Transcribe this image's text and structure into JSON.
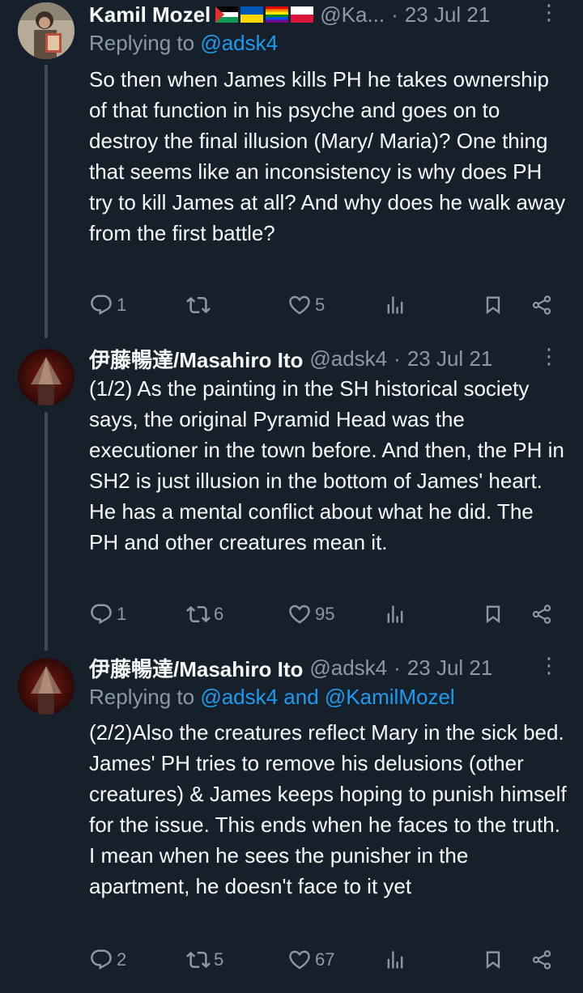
{
  "tweets": [
    {
      "author_name": "Kamil Mozel",
      "flags": [
        "palestine-flag",
        "ukraine-flag",
        "rainbow-flag",
        "poland-flag"
      ],
      "handle": "@Ka...",
      "date": "23 Jul 21",
      "replying_prefix": "Replying to",
      "replying_to": "@adsk4",
      "text": "So then when James kills PH he takes ownership of that function in his psyche and goes on to destroy the final illusion (Mary/ Maria)? One thing that seems like an inconsistency is why does PH try to kill James at all? And why does he walk away from the first battle?",
      "replies": "1",
      "retweets": "",
      "likes": "5"
    },
    {
      "author_name": "伊藤暢達/Masahiro Ito",
      "handle": "@adsk4",
      "date": "23 Jul 21",
      "text": "(1/2) As the painting in the SH historical society says, the original Pyramid Head was the executioner in the town before. And then, the PH in SH2 is just illusion in the bottom of James' heart. He has a mental conflict about what he did. The PH and other creatures mean it.",
      "replies": "1",
      "retweets": "6",
      "likes": "95"
    },
    {
      "author_name": "伊藤暢達/Masahiro Ito",
      "handle": "@adsk4",
      "date": "23 Jul 21",
      "replying_prefix": "Replying to",
      "replying_to": "@adsk4 and @KamilMozel",
      "text": "(2/2)Also the creatures reflect Mary in the sick bed. James' PH tries to remove his delusions (other creatures) & James keeps hoping to punish himself for the issue. This ends when he faces to the truth. I mean when he sees the punisher in the apartment, he doesn't face to it yet",
      "replies": "2",
      "retweets": "5",
      "likes": "67"
    }
  ],
  "colors": {
    "background": "#15202b",
    "text": "#f7f9f9",
    "muted": "#8b98a5",
    "link": "#1d9bf0"
  }
}
